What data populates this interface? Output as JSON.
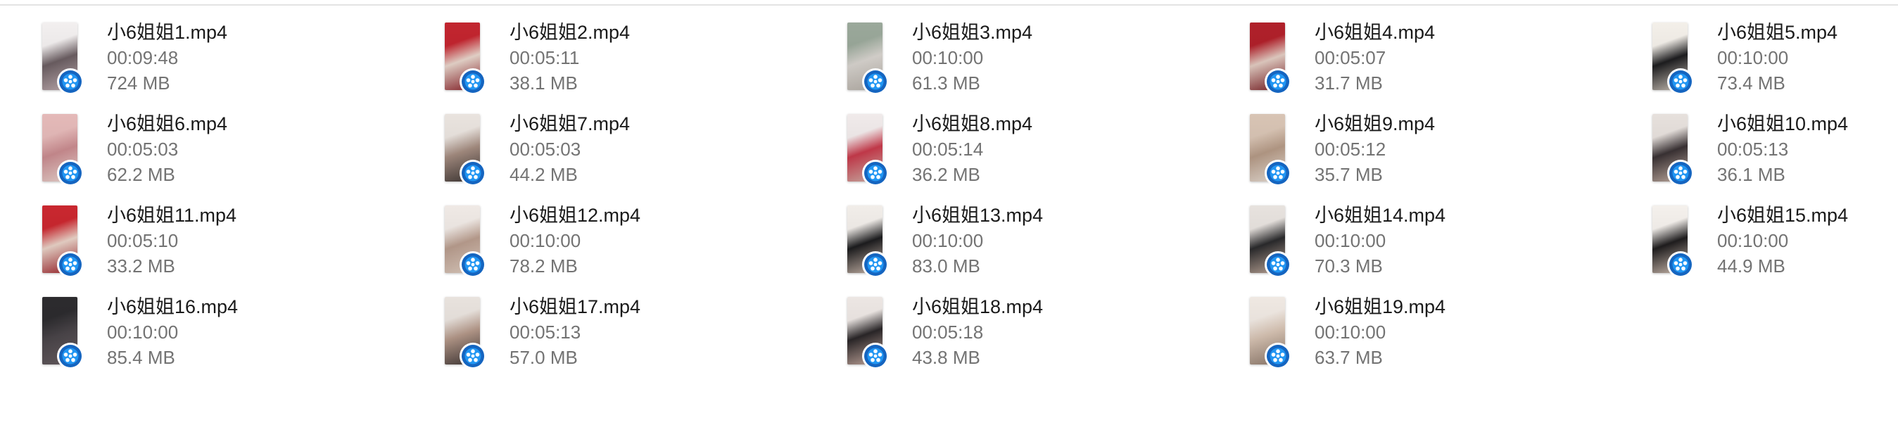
{
  "files": [
    {
      "name": "小6姐姐1.mp4",
      "duration": "00:09:48",
      "size": "724 MB",
      "thumb_colors": [
        "#f2efef",
        "#6b5e62",
        "#c8b4b8"
      ]
    },
    {
      "name": "小6姐姐2.mp4",
      "duration": "00:05:11",
      "size": "38.1 MB",
      "thumb_colors": [
        "#c2252f",
        "#e8d6cc",
        "#8a1c24"
      ]
    },
    {
      "name": "小6姐姐3.mp4",
      "duration": "00:10:00",
      "size": "61.3 MB",
      "thumb_colors": [
        "#9aa89a",
        "#d8d4cf",
        "#b7b0a8"
      ]
    },
    {
      "name": "小6姐姐4.mp4",
      "duration": "00:05:07",
      "size": "31.7 MB",
      "thumb_colors": [
        "#b0202a",
        "#e3cdc3",
        "#7a1a20"
      ]
    },
    {
      "name": "小6姐姐5.mp4",
      "duration": "00:10:00",
      "size": "73.4 MB",
      "thumb_colors": [
        "#f3efe9",
        "#1d1d1f",
        "#d9cfc4"
      ]
    },
    {
      "name": "小6姐姐6.mp4",
      "duration": "00:05:03",
      "size": "62.2 MB",
      "thumb_colors": [
        "#e4b9b8",
        "#c98b8f",
        "#f1dcd6"
      ]
    },
    {
      "name": "小6姐姐7.mp4",
      "duration": "00:05:03",
      "size": "44.2 MB",
      "thumb_colors": [
        "#e9e3de",
        "#a48c80",
        "#3b3432"
      ]
    },
    {
      "name": "小6姐姐8.mp4",
      "duration": "00:05:14",
      "size": "36.2 MB",
      "thumb_colors": [
        "#f0eaea",
        "#c73a4b",
        "#d6b8ae"
      ]
    },
    {
      "name": "小6姐姐9.mp4",
      "duration": "00:05:12",
      "size": "35.7 MB",
      "thumb_colors": [
        "#d8c4b4",
        "#b59a86",
        "#efe5dc"
      ]
    },
    {
      "name": "小6姐姐10.mp4",
      "duration": "00:05:13",
      "size": "36.1 MB",
      "thumb_colors": [
        "#e6e0dc",
        "#3a3234",
        "#cdb7ab"
      ]
    },
    {
      "name": "小6姐姐11.mp4",
      "duration": "00:05:10",
      "size": "33.2 MB",
      "thumb_colors": [
        "#c9272f",
        "#e9d3c8",
        "#9e1f27"
      ]
    },
    {
      "name": "小6姐姐12.mp4",
      "duration": "00:10:00",
      "size": "78.2 MB",
      "thumb_colors": [
        "#efe9e5",
        "#b99d8e",
        "#e4d2c5"
      ]
    },
    {
      "name": "小6姐姐13.mp4",
      "duration": "00:10:00",
      "size": "83.0 MB",
      "thumb_colors": [
        "#f1ede9",
        "#1c1c1e",
        "#d7c3b6"
      ]
    },
    {
      "name": "小6姐姐14.mp4",
      "duration": "00:10:00",
      "size": "70.3 MB",
      "thumb_colors": [
        "#e7e2de",
        "#2a2a2c",
        "#cbb2a3"
      ]
    },
    {
      "name": "小6姐姐15.mp4",
      "duration": "00:10:00",
      "size": "44.9 MB",
      "thumb_colors": [
        "#f4f0ec",
        "#1f1d1e",
        "#dcc9bc"
      ]
    },
    {
      "name": "小6姐姐16.mp4",
      "duration": "00:10:00",
      "size": "85.4 MB",
      "thumb_colors": [
        "#2c2b2e",
        "#4a4549",
        "#6a6064"
      ]
    },
    {
      "name": "小6姐姐17.mp4",
      "duration": "00:05:13",
      "size": "57.0 MB",
      "thumb_colors": [
        "#e8e2dd",
        "#b49889",
        "#3e3534"
      ]
    },
    {
      "name": "小6姐姐18.mp4",
      "duration": "00:05:18",
      "size": "43.8 MB",
      "thumb_colors": [
        "#ece6e3",
        "#2a2628",
        "#d1b3a8"
      ]
    },
    {
      "name": "小6姐姐19.mp4",
      "duration": "00:10:00",
      "size": "63.7 MB",
      "thumb_colors": [
        "#efe8e2",
        "#d6c2b2",
        "#8f7a6c"
      ]
    }
  ],
  "badge": {
    "icon": "video-player-badge-icon",
    "outer_color": "#1565c0",
    "inner_color": "#2196f3",
    "ring_color": "#ffffff"
  }
}
